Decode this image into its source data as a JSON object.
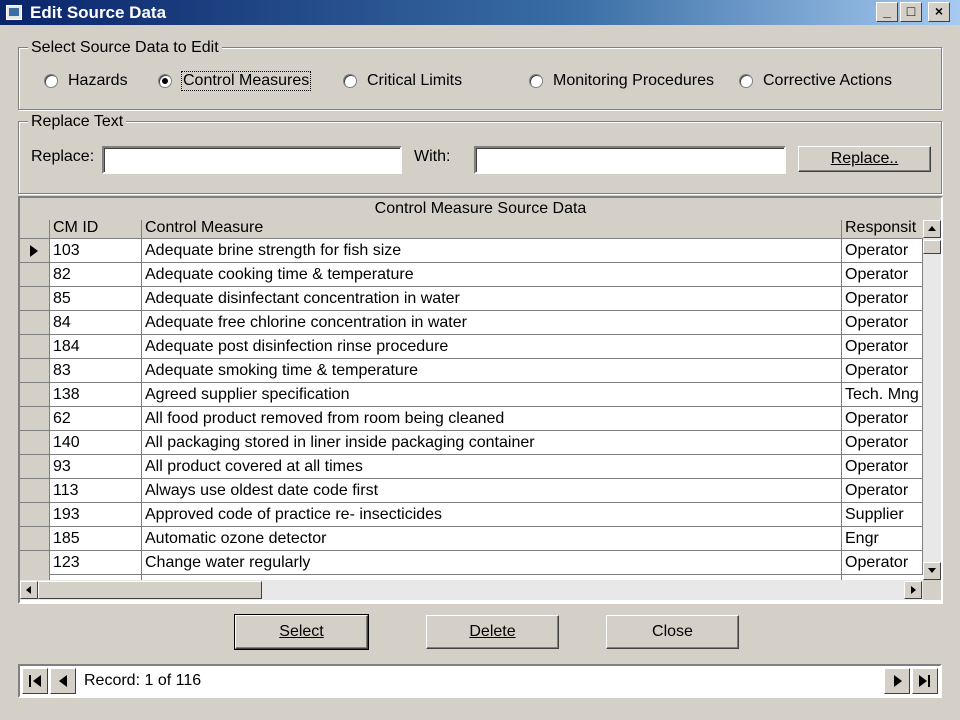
{
  "window": {
    "title": "Edit Source Data",
    "minimize": "_",
    "maximize": "□",
    "close": "×"
  },
  "select_group": {
    "legend": "Select Source Data to Edit",
    "options": [
      {
        "label": "Hazards",
        "checked": false
      },
      {
        "label": "Control Measures",
        "checked": true
      },
      {
        "label": "Critical Limits",
        "checked": false
      },
      {
        "label": "Monitoring Procedures",
        "checked": false
      },
      {
        "label": "Corrective Actions",
        "checked": false
      }
    ]
  },
  "replace_group": {
    "legend": "Replace Text",
    "replace_label": "Replace:",
    "replace_value": "",
    "with_label": "With:",
    "with_value": "",
    "button_label": "Replace.."
  },
  "grid": {
    "caption": "Control Measure Source Data",
    "columns": [
      "CM ID",
      "Control Measure",
      "Responsit"
    ],
    "rows": [
      [
        "103",
        "Adequate brine strength for fish size",
        "Operator"
      ],
      [
        "82",
        "Adequate cooking time & temperature",
        "Operator"
      ],
      [
        "85",
        "Adequate disinfectant concentration in water",
        "Operator"
      ],
      [
        "84",
        "Adequate free chlorine concentration in water",
        "Operator"
      ],
      [
        "184",
        "Adequate post disinfection rinse procedure",
        "Operator"
      ],
      [
        "83",
        "Adequate smoking time & temperature",
        "Operator"
      ],
      [
        "138",
        "Agreed supplier specification",
        "Tech. Mng"
      ],
      [
        "62",
        "All food product removed from room being cleaned",
        "Operator"
      ],
      [
        "140",
        "All packaging stored in liner inside packaging container",
        "Operator"
      ],
      [
        "93",
        "All product covered at all times",
        "Operator"
      ],
      [
        "113",
        "Always use oldest date code first",
        "Operator"
      ],
      [
        "193",
        "Approved code of practice re- insecticides",
        "Supplier"
      ],
      [
        "185",
        "Automatic ozone detector",
        "Engr"
      ],
      [
        "123",
        "Change water regularly",
        "Operator"
      ]
    ],
    "selected_row": 0
  },
  "buttons": {
    "select": "Select",
    "delete": "Delete",
    "close": "Close"
  },
  "navigator": {
    "record_text": "Record: 1 of 116"
  }
}
